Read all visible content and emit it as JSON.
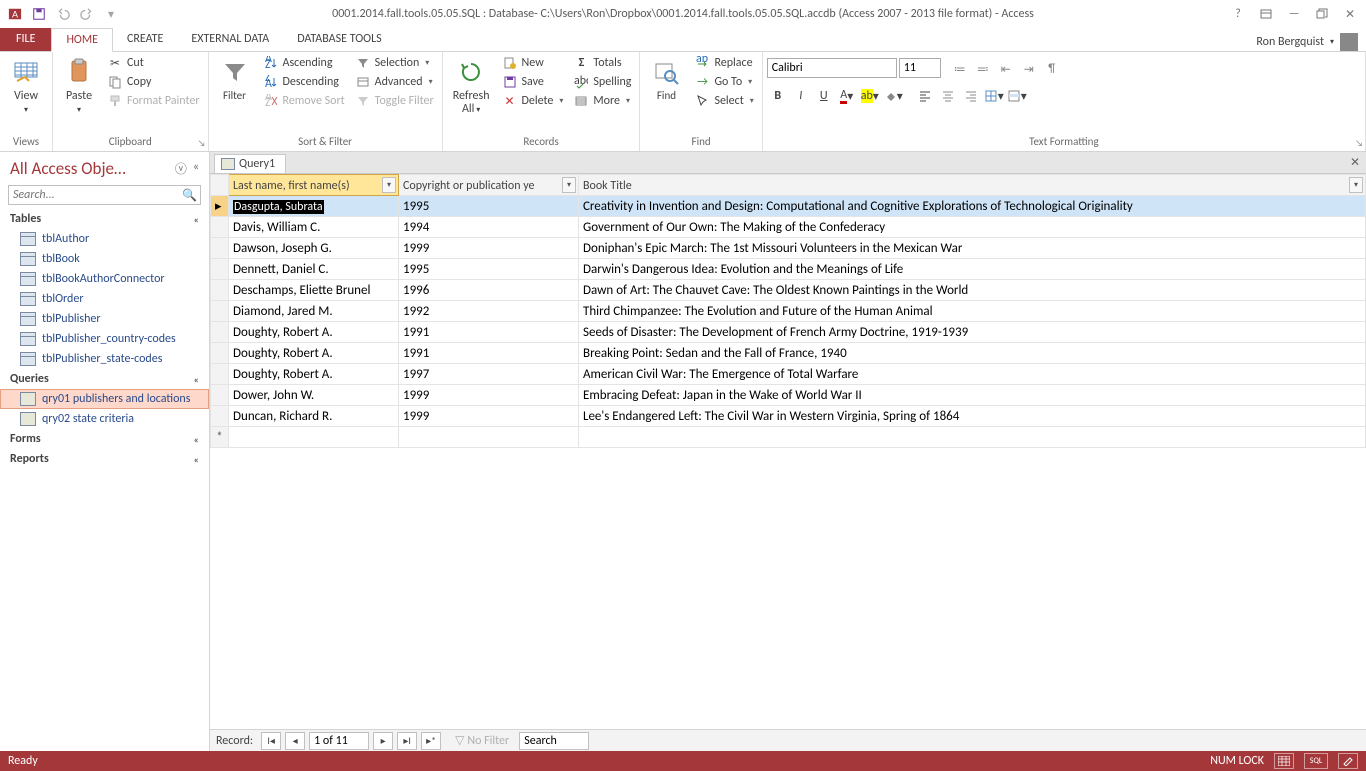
{
  "title": "0001.2014.fall.tools.05.05.SQL : Database- C:\\Users\\Ron\\Dropbox\\0001.2014.fall.tools.05.05.SQL.accdb (Access 2007 - 2013 file format) - Access",
  "user": "Ron Bergquist",
  "tabs": {
    "file": "FILE",
    "home": "HOME",
    "create": "CREATE",
    "external": "EXTERNAL DATA",
    "dbtools": "DATABASE TOOLS"
  },
  "ribbon": {
    "views": {
      "view": "View",
      "group": "Views"
    },
    "clipboard": {
      "paste": "Paste",
      "cut": "Cut",
      "copy": "Copy",
      "painter": "Format Painter",
      "group": "Clipboard"
    },
    "sortfilter": {
      "filter": "Filter",
      "asc": "Ascending",
      "desc": "Descending",
      "remove": "Remove Sort",
      "selection": "Selection",
      "advanced": "Advanced",
      "toggle": "Toggle Filter",
      "group": "Sort & Filter"
    },
    "records": {
      "refresh": "Refresh\nAll",
      "new": "New",
      "save": "Save",
      "delete": "Delete",
      "totals": "Totals",
      "spelling": "Spelling",
      "more": "More",
      "group": "Records"
    },
    "find": {
      "find": "Find",
      "replace": "Replace",
      "goto": "Go To",
      "select": "Select",
      "group": "Find"
    },
    "textfmt": {
      "font": "Calibri",
      "size": "11",
      "group": "Text Formatting"
    }
  },
  "nav": {
    "title": "All Access Obje…",
    "search_placeholder": "Search...",
    "sections": {
      "tables": "Tables",
      "queries": "Queries",
      "forms": "Forms",
      "reports": "Reports"
    },
    "tables": [
      "tblAuthor",
      "tblBook",
      "tblBookAuthorConnector",
      "tblOrder",
      "tblPublisher",
      "tblPublisher_country-codes",
      "tblPublisher_state-codes"
    ],
    "queries": [
      "qry01 publishers and locations",
      "qry02 state criteria"
    ],
    "selected_query": "qry01 publishers and locations"
  },
  "doc": {
    "tab": "Query1",
    "columns": [
      "Last name, first name(s)",
      "Copyright or publication ye",
      "Book Title"
    ],
    "rows": [
      {
        "name": "Dasgupta, Subrata",
        "year": "1995",
        "title": "Creativity in Invention and Design: Computational and Cognitive Explorations of Technological Originality"
      },
      {
        "name": "Davis, William C.",
        "year": "1994",
        "title": "Government of Our Own: The Making of the Confederacy"
      },
      {
        "name": "Dawson, Joseph G.",
        "year": "1999",
        "title": "Doniphan's Epic March: The 1st Missouri Volunteers in the Mexican War"
      },
      {
        "name": "Dennett, Daniel C.",
        "year": "1995",
        "title": "Darwin's Dangerous Idea: Evolution and the Meanings of Life"
      },
      {
        "name": "Deschamps, Eliette Brunel",
        "year": "1996",
        "title": "Dawn of Art: The Chauvet Cave: The Oldest Known Paintings in the World"
      },
      {
        "name": "Diamond, Jared M.",
        "year": "1992",
        "title": "Third Chimpanzee: The Evolution and Future of the Human Animal"
      },
      {
        "name": "Doughty, Robert A.",
        "year": "1991",
        "title": "Seeds of Disaster: The Development of French Army Doctrine, 1919-1939"
      },
      {
        "name": "Doughty, Robert A.",
        "year": "1991",
        "title": "Breaking Point: Sedan and the Fall of France, 1940"
      },
      {
        "name": "Doughty, Robert A.",
        "year": "1997",
        "title": "American Civil War: The Emergence of Total Warfare"
      },
      {
        "name": "Dower, John W.",
        "year": "1999",
        "title": "Embracing Defeat: Japan in the Wake of World War II"
      },
      {
        "name": "Duncan,  Richard R.",
        "year": "1999",
        "title": "Lee's Endangered Left: The Civil War in Western Virginia, Spring of 1864"
      }
    ],
    "recnav": {
      "label": "Record:",
      "pos": "1 of 11",
      "nofilter": "No Filter",
      "search": "Search"
    }
  },
  "status": {
    "ready": "Ready",
    "numlock": "NUM LOCK",
    "sql": "SQL"
  }
}
